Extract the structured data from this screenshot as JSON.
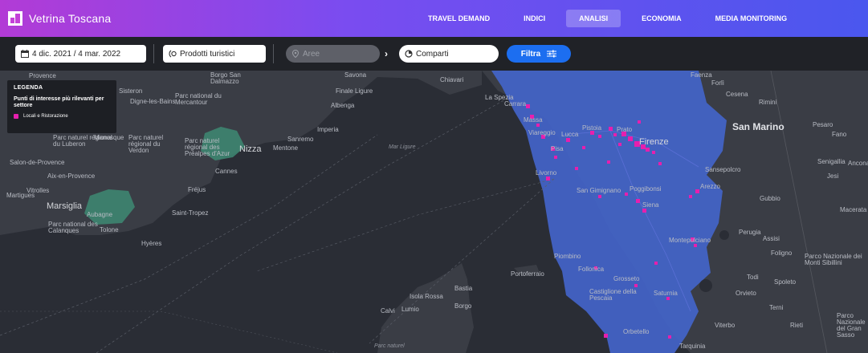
{
  "app": {
    "title": "Vetrina Toscana"
  },
  "nav": {
    "items": [
      {
        "label": "TRAVEL DEMAND",
        "active": false
      },
      {
        "label": "INDICI",
        "active": false
      },
      {
        "label": "ANALISI",
        "active": true
      },
      {
        "label": "ECONOMIA",
        "active": false
      },
      {
        "label": "MEDIA MONITORING",
        "active": false
      }
    ]
  },
  "toolbar": {
    "date_range": "4 dic. 2021 / 4 mar. 2022",
    "products": "Prodotti turistici",
    "areas_placeholder": "Aree",
    "sectors": "Comparti",
    "filter_label": "Filtra"
  },
  "legend": {
    "title": "LEGENDA",
    "subtitle": "Punti di interesse più rilevanti per settore",
    "items": [
      {
        "label": "Locali e Ristorazione",
        "color": "#e61fae"
      }
    ]
  },
  "map": {
    "places": [
      "Savona",
      "Finale Ligure",
      "Albenga",
      "Imperia",
      "Sanremo",
      "Mentone",
      "Nizza",
      "Cannes",
      "Fréjus",
      "Saint-Tropez",
      "Marsiglia",
      "Aubagne",
      "Tolone",
      "Hyères",
      "Aix-en-Provence",
      "Vitrolles",
      "Salon-de-Provence",
      "Martigues",
      "Parc naturel régional du Luberon",
      "Parc naturel régional du Verdon",
      "Parc naturel régional des Préalpes d'Azur",
      "Parc national du Mercantour",
      "Digne-les-Bains",
      "Parc national des Calanques",
      "Borgo San Dalmazzo",
      "Manosque",
      "Sisteron",
      "Chiavari",
      "La Spezia",
      "Carrara",
      "Massa",
      "Viareggio",
      "Lucca",
      "Pistoia",
      "Prato",
      "Firenze",
      "Pisa",
      "Livorno",
      "San Gimignano",
      "Poggibonsi",
      "Siena",
      "Arezzo",
      "Montepulciano",
      "Piombino",
      "Follonica",
      "Portoferraio",
      "Grosseto",
      "Castiglione della Pescaia",
      "Saturnia",
      "Orbetello",
      "Isola Rossa",
      "Calvi",
      "Bastia",
      "Borgo",
      "Lumio",
      "Faenza",
      "Forlì",
      "Cesena",
      "Rimini",
      "San Marino",
      "Pesaro",
      "Fano",
      "Senigallia",
      "Ancona",
      "Jesi",
      "Gubbio",
      "Perugia",
      "Assisi",
      "Foligno",
      "Spoleto",
      "Todi",
      "Orvieto",
      "Terni",
      "Viterbo",
      "Rieti",
      "Macerata",
      "Parco Nazionale dei Monti Sibillini",
      "Parco Nazionale del Gran Sasso",
      "Tarquinia",
      "Sansepolcro",
      "Mar Ligure",
      "Parc naturel",
      "Provence"
    ]
  }
}
